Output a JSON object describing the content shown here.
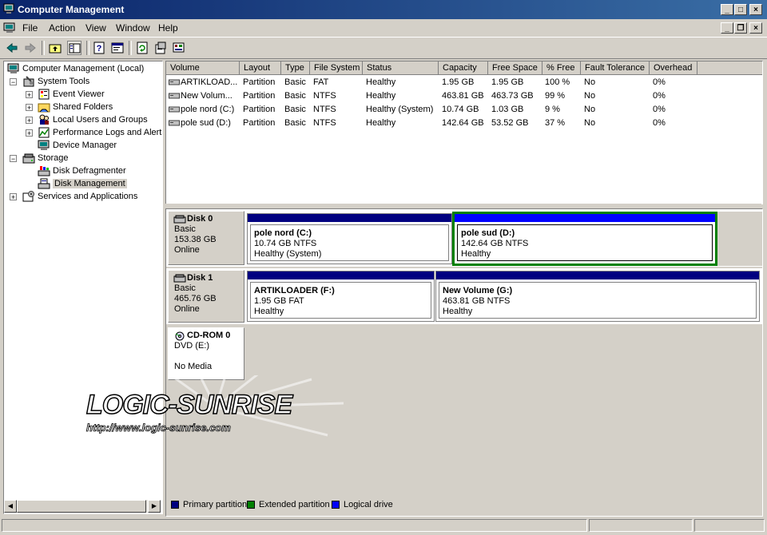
{
  "window": {
    "title": "Computer Management"
  },
  "menu": [
    "File",
    "Action",
    "View",
    "Window",
    "Help"
  ],
  "tree": {
    "root": "Computer Management (Local)",
    "system_tools": "System Tools",
    "event_viewer": "Event Viewer",
    "shared_folders": "Shared Folders",
    "local_users": "Local Users and Groups",
    "perf_logs": "Performance Logs and Alerts",
    "device_manager": "Device Manager",
    "storage": "Storage",
    "defrag": "Disk Defragmenter",
    "disk_mgmt": "Disk Management",
    "services": "Services and Applications"
  },
  "volumes": {
    "columns": [
      "Volume",
      "Layout",
      "Type",
      "File System",
      "Status",
      "Capacity",
      "Free Space",
      "% Free",
      "Fault Tolerance",
      "Overhead"
    ],
    "rows": [
      [
        "ARTIKLOAD...",
        "Partition",
        "Basic",
        "FAT",
        "Healthy",
        "1.95 GB",
        "1.95 GB",
        "100 %",
        "No",
        "0%"
      ],
      [
        "New Volum...",
        "Partition",
        "Basic",
        "NTFS",
        "Healthy",
        "463.81 GB",
        "463.73 GB",
        "99 %",
        "No",
        "0%"
      ],
      [
        "pole nord (C:)",
        "Partition",
        "Basic",
        "NTFS",
        "Healthy (System)",
        "10.74 GB",
        "1.03 GB",
        "9 %",
        "No",
        "0%"
      ],
      [
        "pole sud (D:)",
        "Partition",
        "Basic",
        "NTFS",
        "Healthy",
        "142.64 GB",
        "53.52 GB",
        "37 %",
        "No",
        "0%"
      ]
    ]
  },
  "disks": {
    "disk0": {
      "name": "Disk 0",
      "type": "Basic",
      "size": "153.38 GB",
      "status": "Online",
      "p1": {
        "name": "pole nord  (C:)",
        "size": "10.74 GB NTFS",
        "status": "Healthy (System)"
      },
      "p2": {
        "name": "pole sud  (D:)",
        "size": "142.64 GB NTFS",
        "status": "Healthy"
      }
    },
    "disk1": {
      "name": "Disk 1",
      "type": "Basic",
      "size": "465.76 GB",
      "status": "Online",
      "p1": {
        "name": "ARTIKLOADER  (F:)",
        "size": "1.95 GB FAT",
        "status": "Healthy"
      },
      "p2": {
        "name": "New Volume  (G:)",
        "size": "463.81 GB NTFS",
        "status": "Healthy"
      }
    },
    "cdrom": {
      "name": "CD-ROM 0",
      "drive": "DVD (E:)",
      "status": "No Media"
    }
  },
  "legend": {
    "primary": "Primary partition",
    "extended": "Extended partition",
    "logical": "Logical drive"
  },
  "colors": {
    "primary": "#000080",
    "extended": "#008000",
    "logical": "#0000ff",
    "title_start": "#0a246a",
    "title_end": "#3a6ea5"
  },
  "watermark": {
    "brand": "LOGIC-SUNRISE",
    "url": "http://www.logic-sunrise.com"
  }
}
